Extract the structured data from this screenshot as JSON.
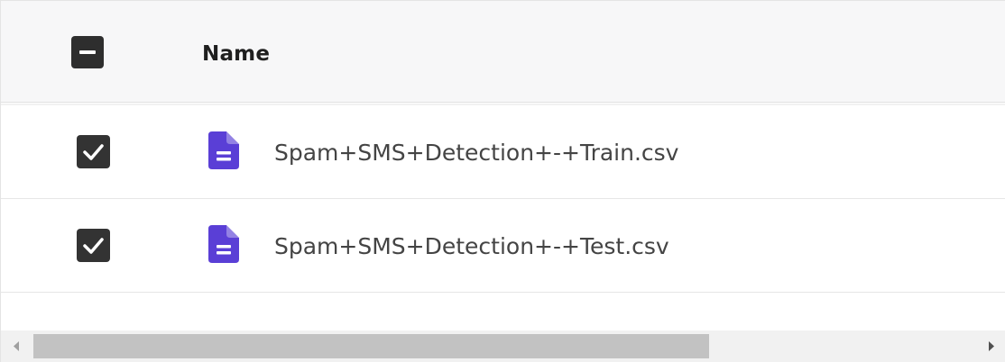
{
  "table": {
    "header": {
      "select_all_state": "indeterminate",
      "name_label": "Name"
    },
    "rows": [
      {
        "checked": true,
        "icon": "document-icon",
        "file_name": "Spam+SMS+Detection+-+Train.csv"
      },
      {
        "checked": true,
        "icon": "document-icon",
        "file_name": "Spam+SMS+Detection+-+Test.csv"
      }
    ]
  },
  "colors": {
    "header_bg": "#f7f7f8",
    "checkbox": "#333333",
    "file_icon": "#5a3fd6",
    "scroll_track": "#f1f1f1",
    "scroll_thumb": "#c2c2c2"
  },
  "scrollbar": {
    "orientation": "horizontal",
    "visible_fraction": 0.67,
    "scroll_position": 0
  }
}
